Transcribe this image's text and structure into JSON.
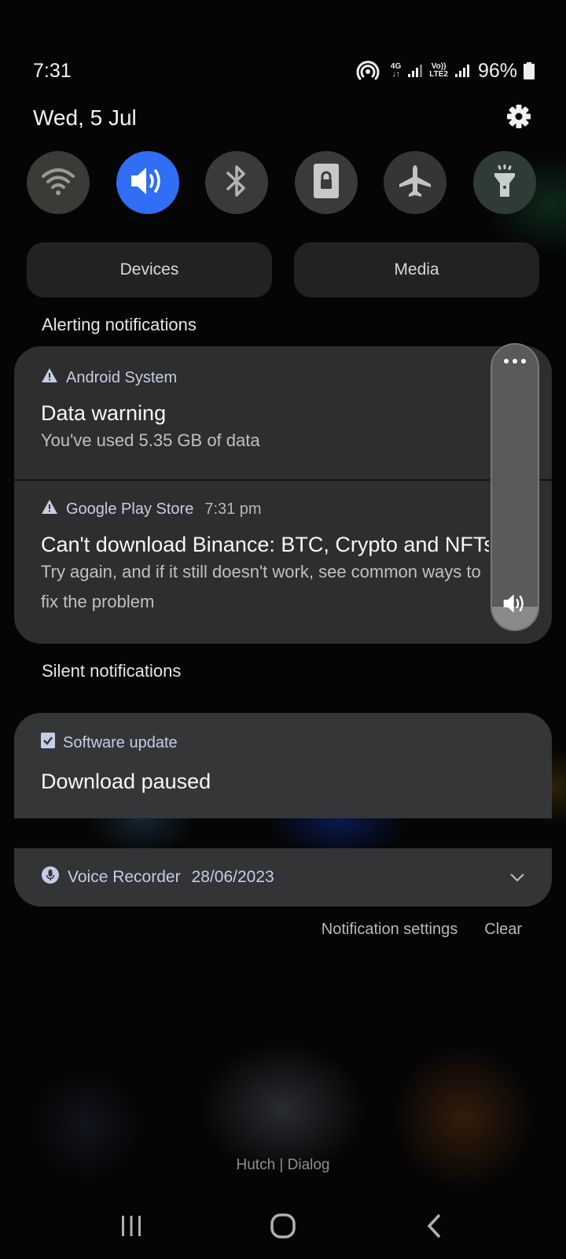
{
  "status_bar": {
    "time": "7:31",
    "network_label": "4G",
    "volte_label_top": "Vo))",
    "volte_label_bottom": "LTE2",
    "battery": "96%"
  },
  "header": {
    "date": "Wed, 5 Jul"
  },
  "quick_toggles": [
    {
      "id": "wifi",
      "label": "Wi-Fi",
      "active": false
    },
    {
      "id": "sound",
      "label": "Sound",
      "active": true
    },
    {
      "id": "bluetooth",
      "label": "Bluetooth",
      "active": false
    },
    {
      "id": "portrait-lock",
      "label": "Portrait lock",
      "active": false
    },
    {
      "id": "airplane",
      "label": "Airplane mode",
      "active": false
    },
    {
      "id": "flashlight",
      "label": "Flashlight",
      "active": false
    }
  ],
  "panel_buttons": {
    "devices": "Devices",
    "media": "Media"
  },
  "alerting": {
    "label": "Alerting notifications",
    "items": [
      {
        "app": "Android System",
        "time": "",
        "title": "Data warning",
        "body": "You've used 5.35 GB of data"
      },
      {
        "app": "Google Play Store",
        "time": "7:31 pm",
        "title": "Can't download Binance: BTC, Crypto and NFTs",
        "body": "Try again, and if it still doesn't work, see common ways to fix the problem"
      }
    ]
  },
  "silent": {
    "label": "Silent notifications",
    "items": [
      {
        "app": "Software update",
        "title": "Download paused"
      },
      {
        "app": "Voice Recorder",
        "time": "28/06/2023"
      }
    ]
  },
  "volume_panel": {
    "level_fraction": 0.08
  },
  "footer": {
    "settings_label": "Notification settings",
    "clear_label": "Clear",
    "carrier": "Hutch | Dialog"
  },
  "colors": {
    "accent": "#2f6ef5",
    "card": "#2e2e2e"
  }
}
